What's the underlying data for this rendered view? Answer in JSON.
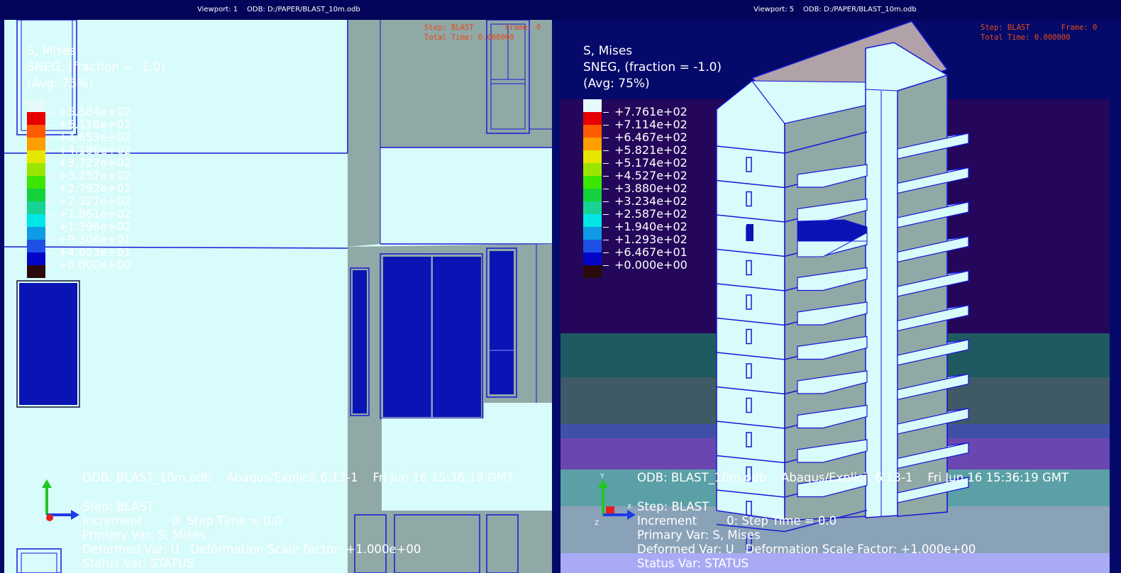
{
  "viewport_left": {
    "title": "Viewport: 1",
    "odb": "ODB: D:/PAPER/BLAST_10m.odb",
    "step_line": "Step: BLAST       Frame: 0",
    "time_line": "Total Time: 0.000000",
    "legend": {
      "line1": "S, Mises",
      "line2": "SNEG, (fraction = -1.0)",
      "line3": "(Avg: 75%)",
      "values": [
        "+5.584e+02",
        "+5.118e+02",
        "+4.653e+02",
        "+4.188e+02",
        "+3.722e+02",
        "+3.257e+02",
        "+2.792e+02",
        "+2.327e+02",
        "+1.861e+02",
        "+1.396e+02",
        "+9.306e+01",
        "+4.653e+01",
        "+0.000e+00"
      ]
    },
    "info": {
      "odb_line": "ODB: BLAST_10m.odb    Abaqus/Explicit 6.13-1    Fri Jun 16 15:36:19 GMT",
      "step": "Step: BLAST",
      "increment": "Increment        0: Step Time = 0.0",
      "primary": "Primary Var: S, Mises",
      "deformed": "Deformed Var: U   Deformation Scale Factor: +1.000e+00",
      "status": "Status Var: STATUS"
    },
    "triad": {
      "y": "Y",
      "x": "X",
      "z": "Z"
    }
  },
  "viewport_right": {
    "title": "Viewport: 5",
    "odb": "ODB: D:/PAPER/BLAST_10m.odb",
    "step_line": "Step: BLAST       Frame: 0",
    "time_line": "Total Time: 0.000000",
    "legend": {
      "line1": "S, Mises",
      "line2": "SNEG, (fraction = -1.0)",
      "line3": "(Avg: 75%)",
      "values": [
        "+7.761e+02",
        "+7.114e+02",
        "+6.467e+02",
        "+5.821e+02",
        "+5.174e+02",
        "+4.527e+02",
        "+3.880e+02",
        "+3.234e+02",
        "+2.587e+02",
        "+1.940e+02",
        "+1.293e+02",
        "+6.467e+01",
        "+0.000e+00"
      ]
    },
    "info": {
      "odb_line": "ODB: BLAST_10m.odb    Abaqus/Explicit 6.13-1    Fri Jun 16 15:36:19 GMT",
      "step": "Step: BLAST",
      "increment": "Increment        0: Step Time = 0.0",
      "primary": "Primary Var: S, Mises",
      "deformed": "Deformed Var: U   Deformation Scale Factor: +1.000e+00",
      "status": "Status Var: STATUS"
    },
    "triad": {
      "y": "Y",
      "x": "X",
      "z": "Z"
    }
  },
  "colors": {
    "legend_scale": [
      "#e6fafa",
      "#e60000",
      "#ff5a00",
      "#ff9e00",
      "#e6e600",
      "#9ae600",
      "#3ce600",
      "#14d23c",
      "#19d296",
      "#00e6e6",
      "#0f9be6",
      "#1e50e6",
      "#0505c8",
      "#2a0a0a"
    ],
    "model_face_light": "#d8fbfb",
    "model_face_side": "#90a8a6",
    "model_edge": "#1818d8",
    "damaged": "#0a14b4",
    "roof": "#b0a2a8"
  }
}
